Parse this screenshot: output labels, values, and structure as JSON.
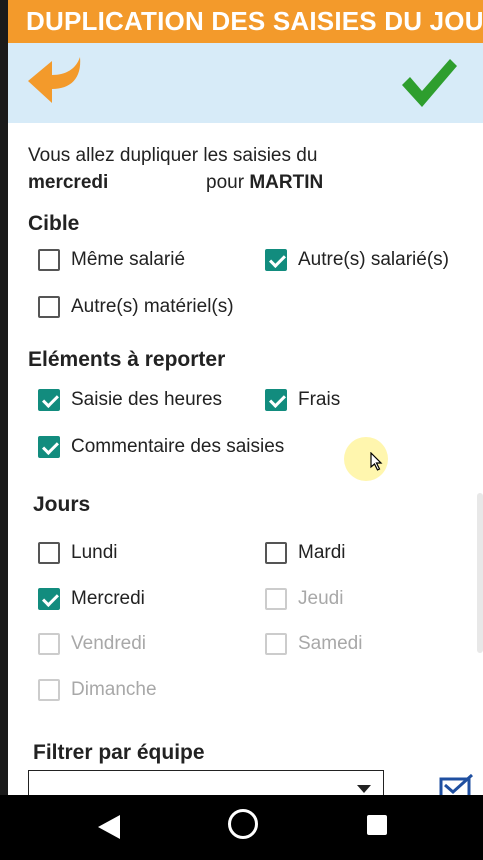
{
  "header": {
    "title": "DUPLICATION DES SAISIES DU JOUR",
    "back_icon": "curved-back-arrow-icon",
    "confirm_icon": "check-icon",
    "accent_color": "#f39a2b",
    "toolbar_bg": "#d7ebf8"
  },
  "intro": {
    "line1": "Vous allez dupliquer les saisies du",
    "day": "mercredi",
    "pour": "pour",
    "name": "MARTIN"
  },
  "cible": {
    "title": "Cible",
    "items": [
      {
        "label": "Même salarié",
        "checked": false
      },
      {
        "label": "Autre(s) salarié(s)",
        "checked": true
      },
      {
        "label": "Autre(s) matériel(s)",
        "checked": false
      }
    ]
  },
  "elements": {
    "title": "Eléments à reporter",
    "items": [
      {
        "label": "Saisie des heures",
        "checked": true
      },
      {
        "label": "Frais",
        "checked": true
      },
      {
        "label": "Commentaire des saisies",
        "checked": true
      }
    ]
  },
  "jours": {
    "title": "Jours",
    "items": [
      {
        "label": "Lundi",
        "checked": false,
        "enabled": true
      },
      {
        "label": "Mardi",
        "checked": false,
        "enabled": true
      },
      {
        "label": "Mercredi",
        "checked": true,
        "enabled": true
      },
      {
        "label": "Jeudi",
        "checked": false,
        "enabled": false
      },
      {
        "label": "Vendredi",
        "checked": false,
        "enabled": false
      },
      {
        "label": "Samedi",
        "checked": false,
        "enabled": false
      },
      {
        "label": "Dimanche",
        "checked": false,
        "enabled": false
      }
    ]
  },
  "filter": {
    "title": "Filtrer par équipe",
    "value": ""
  },
  "checkbox_color": "#128c7e"
}
